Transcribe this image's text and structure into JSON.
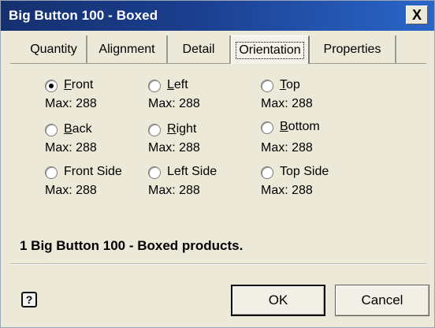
{
  "window": {
    "title": "Big Button 100 - Boxed",
    "close_glyph": "X"
  },
  "tabs": [
    {
      "label": "Quantity",
      "active": false
    },
    {
      "label": "Alignment",
      "active": false
    },
    {
      "label": "Detail",
      "active": false
    },
    {
      "label": "Orientation",
      "active": true
    },
    {
      "label": "Properties",
      "active": false
    }
  ],
  "orientation_options": [
    {
      "label": "Front",
      "max": "Max: 288",
      "checked": true
    },
    {
      "label": "Left",
      "max": "Max: 288",
      "checked": false
    },
    {
      "label": "Top",
      "max": "Max: 288",
      "checked": false
    },
    {
      "label": "Back",
      "max": "Max: 288",
      "checked": false
    },
    {
      "label": "Right",
      "max": "Max: 288",
      "checked": false
    },
    {
      "label": "Bottom",
      "max": "Max: 288",
      "checked": false
    },
    {
      "label": "Front Side",
      "max": "Max: 288",
      "checked": false
    },
    {
      "label": "Left Side",
      "max": "Max: 288",
      "checked": false
    },
    {
      "label": "Top Side",
      "max": "Max: 288",
      "checked": false
    }
  ],
  "status": {
    "text": "1 Big Button 100 - Boxed products."
  },
  "footer": {
    "help_icon": "help-icon",
    "help_glyph": "?",
    "ok_label": "OK",
    "cancel_label": "Cancel"
  }
}
